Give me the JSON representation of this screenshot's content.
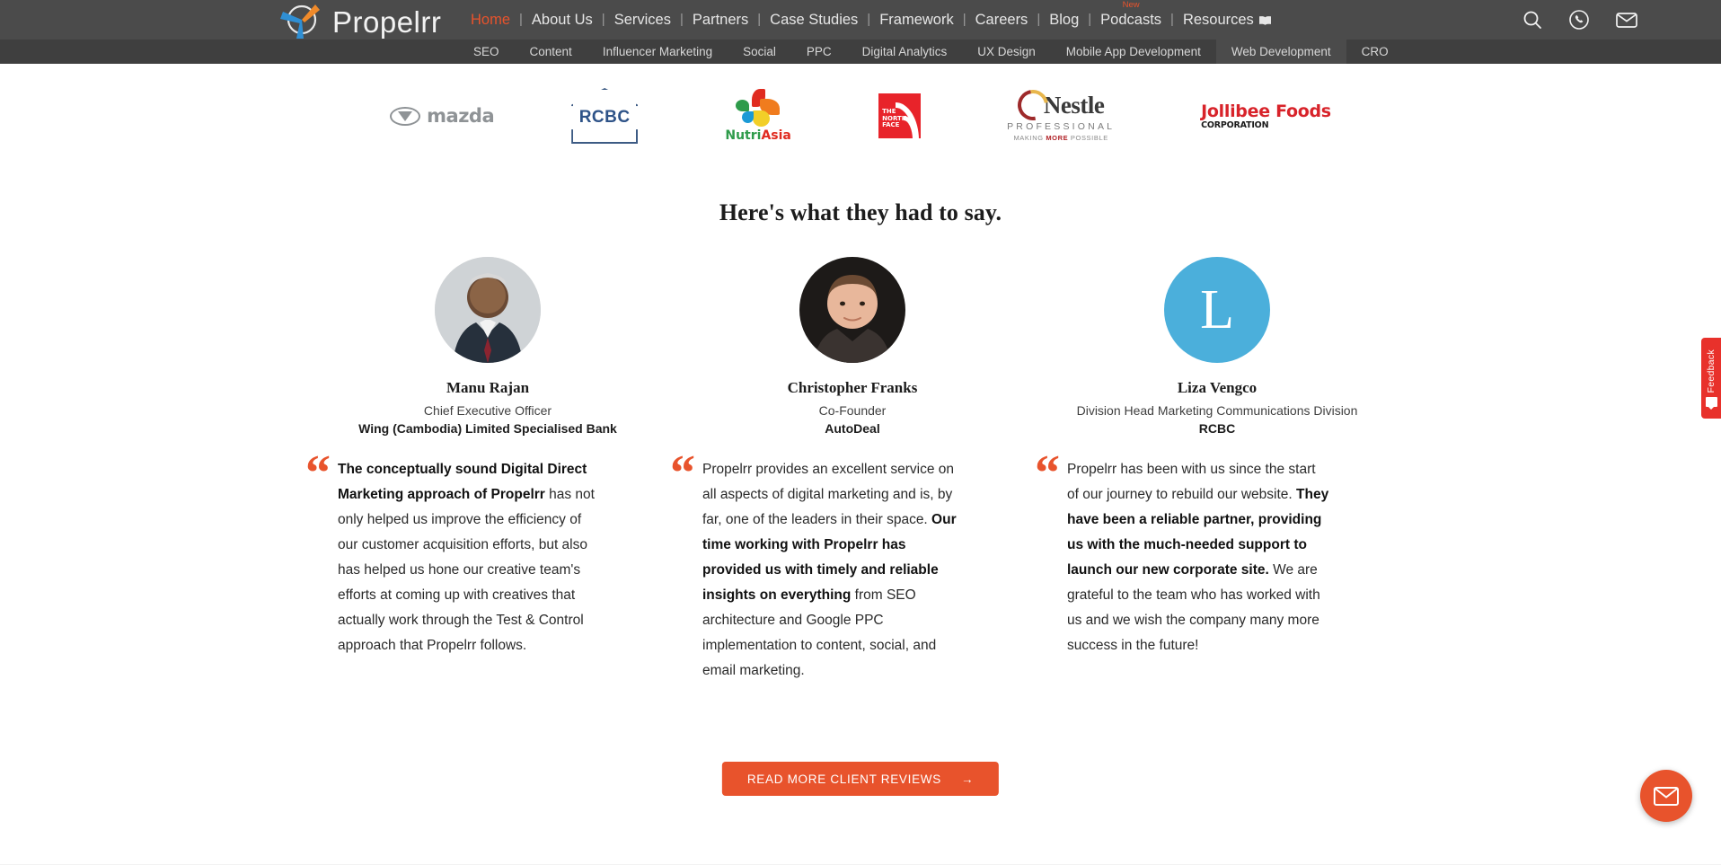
{
  "header": {
    "logo_text": "Propelrr",
    "logo_icon": "propelrr-pinwheel-logo",
    "nav": [
      {
        "label": "Home",
        "active": true
      },
      {
        "label": "About Us",
        "active": false
      },
      {
        "label": "Services",
        "active": false
      },
      {
        "label": "Partners",
        "active": false
      },
      {
        "label": "Case Studies",
        "active": false
      },
      {
        "label": "Framework",
        "active": false
      },
      {
        "label": "Careers",
        "active": false
      },
      {
        "label": "Blog",
        "active": false
      },
      {
        "label": "Podcasts",
        "active": false,
        "badge": "New"
      },
      {
        "label": "Resources",
        "active": false,
        "icon": "book-icon"
      }
    ],
    "separator": "|",
    "tools": [
      {
        "name": "search-icon"
      },
      {
        "name": "phone-icon"
      },
      {
        "name": "mail-icon"
      }
    ]
  },
  "subnav": {
    "items": [
      {
        "label": "SEO",
        "active": false
      },
      {
        "label": "Content",
        "active": false
      },
      {
        "label": "Influencer Marketing",
        "active": false
      },
      {
        "label": "Social",
        "active": false
      },
      {
        "label": "PPC",
        "active": false
      },
      {
        "label": "Digital Analytics",
        "active": false
      },
      {
        "label": "UX Design",
        "active": false
      },
      {
        "label": "Mobile App Development",
        "active": false
      },
      {
        "label": "Web Development",
        "active": true
      },
      {
        "label": "CRO",
        "active": false
      }
    ]
  },
  "client_logos": [
    {
      "name": "mazda-logo",
      "label": "mazda"
    },
    {
      "name": "rcbc-logo",
      "label": "RCBC"
    },
    {
      "name": "nutriasia-logo",
      "label": "NutriAsia"
    },
    {
      "name": "the-north-face-logo",
      "label_line1": "THE",
      "label_line2": "NORTH",
      "label_line3": "FACE"
    },
    {
      "name": "nestle-professional-logo",
      "label": "Nestle",
      "sub": "PROFESSIONAL",
      "tagline_pre": "MAKING ",
      "tagline_bold": "MORE",
      "tagline_post": " POSSIBLE"
    },
    {
      "name": "jollibee-foods-logo",
      "label": "Jollibee Foods",
      "sub": "CORPORATION"
    }
  ],
  "section": {
    "heading": "Here's what they had to say."
  },
  "testimonials": [
    {
      "avatar_type": "photo",
      "avatar_name": "avatar-manu-rajan",
      "name": "Manu Rajan",
      "role": "Chief Executive Officer",
      "company": "Wing (Cambodia) Limited Specialised Bank",
      "quote_mark": "“",
      "quote_bold_lead": "The conceptually sound Digital Direct Marketing approach of Propelrr",
      "quote_rest": " has not only helped us improve the efficiency of our customer acquisition efforts, but also has helped us hone our creative team's efforts at coming up with creatives that actually work through the Test & Control approach that Propelrr follows."
    },
    {
      "avatar_type": "photo",
      "avatar_name": "avatar-christopher-franks",
      "name": "Christopher Franks",
      "role": "Co-Founder",
      "company": "AutoDeal",
      "quote_mark": "“",
      "quote_lead": "Propelrr provides an excellent service on all aspects of digital marketing and is, by far, one of the leaders in their space. ",
      "quote_bold": "Our time working with Propelrr has provided us with timely and reliable insights on everything",
      "quote_rest": " from SEO architecture and Google PPC implementation to content, social, and email marketing."
    },
    {
      "avatar_type": "letter",
      "avatar_name": "avatar-liza-vengco",
      "avatar_letter": "L",
      "avatar_color": "#4bafdb",
      "name": "Liza Vengco",
      "role": "Division Head Marketing Communications Division",
      "company": "RCBC",
      "quote_mark": "“",
      "quote_lead": "Propelrr has been with us since the start of our journey to rebuild our website. ",
      "quote_bold": "They have been a reliable partner, providing us with the much-needed support to launch our new corporate site.",
      "quote_rest": " We are grateful to the team who has worked with us and we wish the company many more success in the future!"
    }
  ],
  "cta": {
    "label": "READ MORE CLIENT REVIEWS",
    "arrow": "→"
  },
  "feedback_tab": {
    "label": "Feedback",
    "icon": "feedback-chat-icon"
  },
  "chat_bubble": {
    "icon": "envelope-icon"
  },
  "colors": {
    "accent": "#e8532c",
    "header_bg": "#4b4b4b",
    "subnav_bg": "#3f3f3f",
    "feedback_red": "#e8312b",
    "avatar_blue": "#4bafdb"
  }
}
